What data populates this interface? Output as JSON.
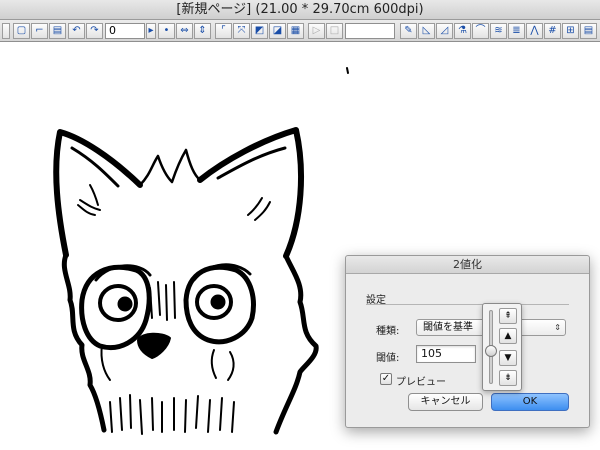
{
  "window": {
    "title": "[新規ページ] (21.00 * 29.70cm 600dpi)"
  },
  "toolbar": {
    "value_field": "0"
  },
  "dialog": {
    "title": "2値化",
    "group_label": "設定",
    "type_label": "種類:",
    "type_value": "閾値を基準",
    "threshold_label": "閾値:",
    "threshold_value": "105",
    "preview_label": "プレビュー",
    "preview_checked": true,
    "check_mark": "✓",
    "cancel_label": "キャンセル",
    "ok_label": "OK"
  },
  "slider_popup": {
    "btn_top": "⇞",
    "btn_up": "▲",
    "btn_down": "▼",
    "btn_bottom": "⇟"
  },
  "colors": {
    "accent": "#3d8ef0",
    "ink": "#000000"
  }
}
